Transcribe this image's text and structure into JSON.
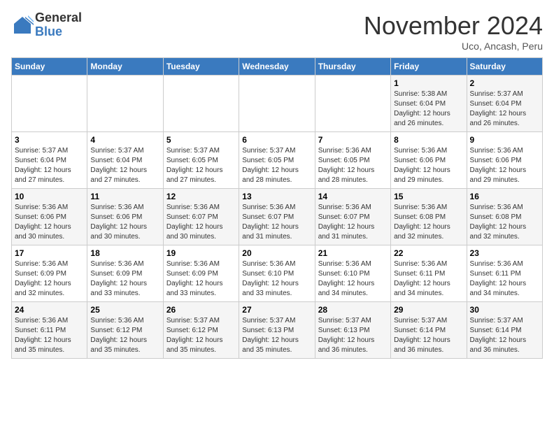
{
  "header": {
    "logo_general": "General",
    "logo_blue": "Blue",
    "month": "November 2024",
    "location": "Uco, Ancash, Peru"
  },
  "days_of_week": [
    "Sunday",
    "Monday",
    "Tuesday",
    "Wednesday",
    "Thursday",
    "Friday",
    "Saturday"
  ],
  "weeks": [
    [
      {
        "day": "",
        "info": ""
      },
      {
        "day": "",
        "info": ""
      },
      {
        "day": "",
        "info": ""
      },
      {
        "day": "",
        "info": ""
      },
      {
        "day": "",
        "info": ""
      },
      {
        "day": "1",
        "info": "Sunrise: 5:38 AM\nSunset: 6:04 PM\nDaylight: 12 hours and 26 minutes."
      },
      {
        "day": "2",
        "info": "Sunrise: 5:37 AM\nSunset: 6:04 PM\nDaylight: 12 hours and 26 minutes."
      }
    ],
    [
      {
        "day": "3",
        "info": "Sunrise: 5:37 AM\nSunset: 6:04 PM\nDaylight: 12 hours and 27 minutes."
      },
      {
        "day": "4",
        "info": "Sunrise: 5:37 AM\nSunset: 6:04 PM\nDaylight: 12 hours and 27 minutes."
      },
      {
        "day": "5",
        "info": "Sunrise: 5:37 AM\nSunset: 6:05 PM\nDaylight: 12 hours and 27 minutes."
      },
      {
        "day": "6",
        "info": "Sunrise: 5:37 AM\nSunset: 6:05 PM\nDaylight: 12 hours and 28 minutes."
      },
      {
        "day": "7",
        "info": "Sunrise: 5:36 AM\nSunset: 6:05 PM\nDaylight: 12 hours and 28 minutes."
      },
      {
        "day": "8",
        "info": "Sunrise: 5:36 AM\nSunset: 6:06 PM\nDaylight: 12 hours and 29 minutes."
      },
      {
        "day": "9",
        "info": "Sunrise: 5:36 AM\nSunset: 6:06 PM\nDaylight: 12 hours and 29 minutes."
      }
    ],
    [
      {
        "day": "10",
        "info": "Sunrise: 5:36 AM\nSunset: 6:06 PM\nDaylight: 12 hours and 30 minutes."
      },
      {
        "day": "11",
        "info": "Sunrise: 5:36 AM\nSunset: 6:06 PM\nDaylight: 12 hours and 30 minutes."
      },
      {
        "day": "12",
        "info": "Sunrise: 5:36 AM\nSunset: 6:07 PM\nDaylight: 12 hours and 30 minutes."
      },
      {
        "day": "13",
        "info": "Sunrise: 5:36 AM\nSunset: 6:07 PM\nDaylight: 12 hours and 31 minutes."
      },
      {
        "day": "14",
        "info": "Sunrise: 5:36 AM\nSunset: 6:07 PM\nDaylight: 12 hours and 31 minutes."
      },
      {
        "day": "15",
        "info": "Sunrise: 5:36 AM\nSunset: 6:08 PM\nDaylight: 12 hours and 32 minutes."
      },
      {
        "day": "16",
        "info": "Sunrise: 5:36 AM\nSunset: 6:08 PM\nDaylight: 12 hours and 32 minutes."
      }
    ],
    [
      {
        "day": "17",
        "info": "Sunrise: 5:36 AM\nSunset: 6:09 PM\nDaylight: 12 hours and 32 minutes."
      },
      {
        "day": "18",
        "info": "Sunrise: 5:36 AM\nSunset: 6:09 PM\nDaylight: 12 hours and 33 minutes."
      },
      {
        "day": "19",
        "info": "Sunrise: 5:36 AM\nSunset: 6:09 PM\nDaylight: 12 hours and 33 minutes."
      },
      {
        "day": "20",
        "info": "Sunrise: 5:36 AM\nSunset: 6:10 PM\nDaylight: 12 hours and 33 minutes."
      },
      {
        "day": "21",
        "info": "Sunrise: 5:36 AM\nSunset: 6:10 PM\nDaylight: 12 hours and 34 minutes."
      },
      {
        "day": "22",
        "info": "Sunrise: 5:36 AM\nSunset: 6:11 PM\nDaylight: 12 hours and 34 minutes."
      },
      {
        "day": "23",
        "info": "Sunrise: 5:36 AM\nSunset: 6:11 PM\nDaylight: 12 hours and 34 minutes."
      }
    ],
    [
      {
        "day": "24",
        "info": "Sunrise: 5:36 AM\nSunset: 6:11 PM\nDaylight: 12 hours and 35 minutes."
      },
      {
        "day": "25",
        "info": "Sunrise: 5:36 AM\nSunset: 6:12 PM\nDaylight: 12 hours and 35 minutes."
      },
      {
        "day": "26",
        "info": "Sunrise: 5:37 AM\nSunset: 6:12 PM\nDaylight: 12 hours and 35 minutes."
      },
      {
        "day": "27",
        "info": "Sunrise: 5:37 AM\nSunset: 6:13 PM\nDaylight: 12 hours and 35 minutes."
      },
      {
        "day": "28",
        "info": "Sunrise: 5:37 AM\nSunset: 6:13 PM\nDaylight: 12 hours and 36 minutes."
      },
      {
        "day": "29",
        "info": "Sunrise: 5:37 AM\nSunset: 6:14 PM\nDaylight: 12 hours and 36 minutes."
      },
      {
        "day": "30",
        "info": "Sunrise: 5:37 AM\nSunset: 6:14 PM\nDaylight: 12 hours and 36 minutes."
      }
    ]
  ]
}
